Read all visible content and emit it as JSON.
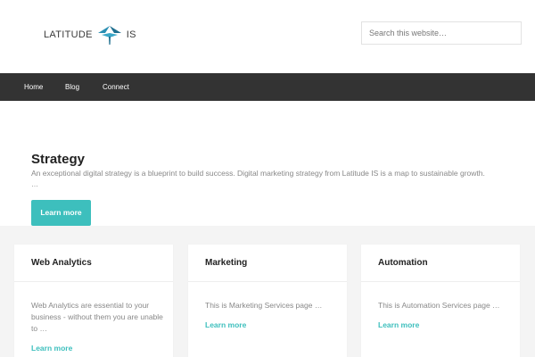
{
  "brand": {
    "left_text": "LATITUDE",
    "right_text": "IS",
    "logo_icon": "compass-arrow-logo",
    "accent_color": "#3dbfbd"
  },
  "search": {
    "placeholder": "Search this website…"
  },
  "nav": {
    "items": [
      {
        "label": "Home"
      },
      {
        "label": "Blog"
      },
      {
        "label": "Connect"
      }
    ]
  },
  "hero": {
    "title": "Strategy",
    "text": "An exceptional digital strategy is a blueprint to build success. Digital marketing strategy from Latitude IS is a map to sustainable growth.",
    "ellipsis": "…",
    "button_label": "Learn more"
  },
  "cards": [
    {
      "title": "Web Analytics",
      "body": "Web Analytics are essential to your business - without them you are unable to …",
      "link": "Learn more"
    },
    {
      "title": "Marketing",
      "body": "This is Marketing Services page …",
      "link": "Learn more"
    },
    {
      "title": "Automation",
      "body": "This is Automation Services page …",
      "link": "Learn more"
    }
  ]
}
